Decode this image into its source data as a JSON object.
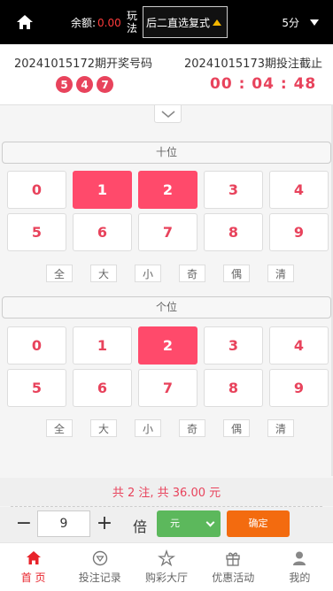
{
  "topbar": {
    "balance_label": "余额:",
    "balance_value": "0.00",
    "play_label": "玩法",
    "play_value": "后二直选复式",
    "period_value": "5分"
  },
  "draw": {
    "last_issue": "20241015172期开奖号码",
    "last_numbers": [
      "5",
      "4",
      "7"
    ],
    "next_issue": "20241015173期投注截止",
    "countdown": "00 : 04 : 48"
  },
  "sections": [
    {
      "title": "十位",
      "numbers": [
        "0",
        "1",
        "2",
        "3",
        "4",
        "5",
        "6",
        "7",
        "8",
        "9"
      ],
      "selected": [
        "1",
        "2"
      ]
    },
    {
      "title": "个位",
      "numbers": [
        "0",
        "1",
        "2",
        "3",
        "4",
        "5",
        "6",
        "7",
        "8",
        "9"
      ],
      "selected": [
        "2"
      ]
    }
  ],
  "filters": [
    "全",
    "大",
    "小",
    "奇",
    "偶",
    "清"
  ],
  "bet": {
    "summary": "共 2 注, 共 36.00 元",
    "minus": "−",
    "multiplier": "9",
    "plus": "+",
    "multiplier_label": "倍",
    "unit": "元",
    "confirm": "确定"
  },
  "nav": [
    {
      "label": "首 页",
      "icon": "home-icon",
      "active": true
    },
    {
      "label": "投注记录",
      "icon": "records-icon",
      "active": false
    },
    {
      "label": "购彩大厅",
      "icon": "lobby-icon",
      "active": false
    },
    {
      "label": "优惠活动",
      "icon": "gift-icon",
      "active": false
    },
    {
      "label": "我的",
      "icon": "user-icon",
      "active": false
    }
  ],
  "colors": {
    "accent": "#e8435c",
    "selected": "#ff4a6b",
    "confirm": "#f36b0f",
    "unit": "#5cb85c",
    "nav_active": "#e8232b"
  }
}
